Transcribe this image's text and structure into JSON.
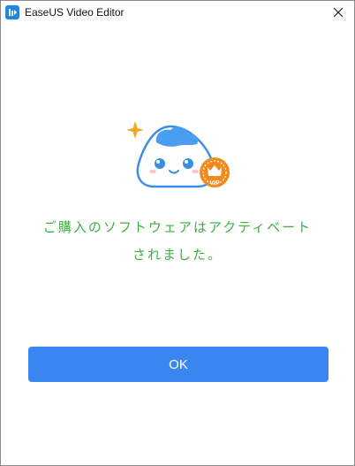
{
  "window": {
    "title": "EaseUS Video Editor"
  },
  "icons": {
    "app": "app-logo-icon",
    "close": "close-icon",
    "mascot": "mascot-illustration",
    "vip_badge": "vip-badge-icon",
    "sparkle": "sparkle-icon"
  },
  "mascot": {
    "badge_text": "VIP"
  },
  "message": {
    "line1": "ご購入のソフトウェアはアクティベート",
    "line2": "されました。"
  },
  "actions": {
    "ok_label": "OK"
  },
  "colors": {
    "accent": "#3a86f0",
    "message_text": "#3cb043",
    "mascot_cloud": "#4a9ef0",
    "badge": "#f08a1c",
    "sparkle": "#f5a623"
  }
}
